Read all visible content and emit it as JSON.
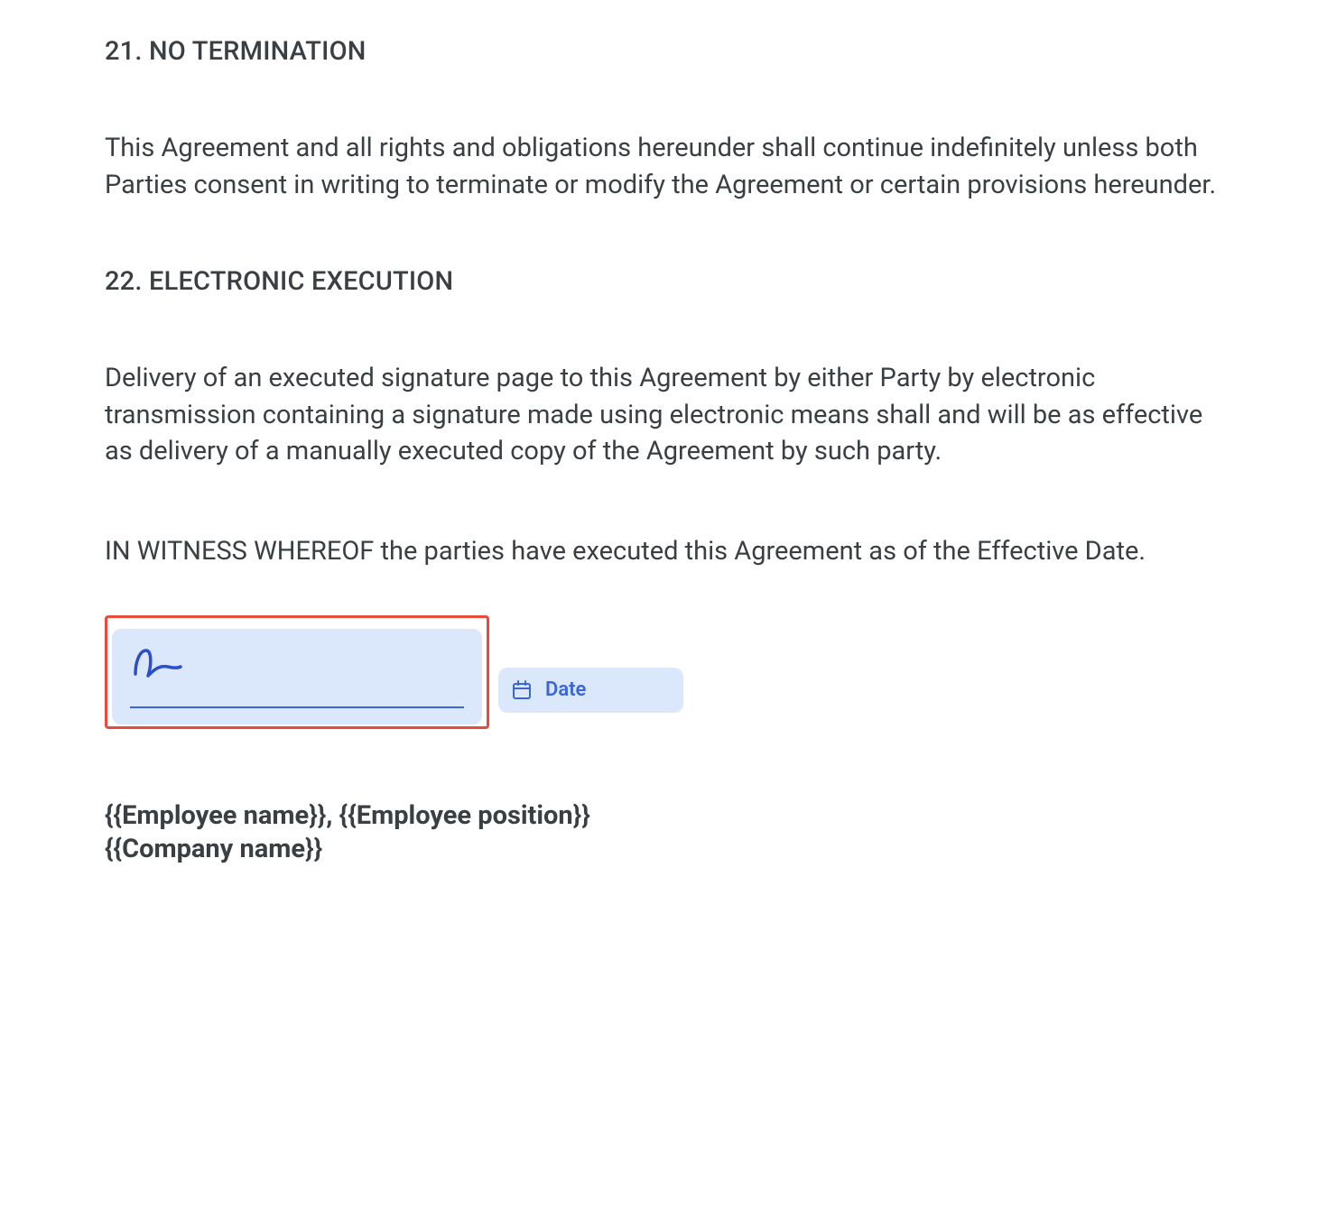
{
  "sections": {
    "s21": {
      "heading": "21. NO TERMINATION",
      "body": "This Agreement and all rights and obligations hereunder shall continue indefinitely unless both Parties consent in writing to terminate or modify the Agreement or certain provisions hereunder."
    },
    "s22": {
      "heading": "22. ELECTRONIC EXECUTION",
      "body": "Delivery of an executed signature page to this Agreement by either Party by electronic transmission containing a signature made using electronic means shall and will be as effective as delivery of a manually executed copy of the Agreement by such party."
    }
  },
  "witness": "IN WITNESS WHEREOF the parties have executed this Agreement as of the Effective Date.",
  "signature": {
    "date_label": "Date"
  },
  "signer": {
    "line1": "{{Employee name}}, {{Employee position}}",
    "line2": "{{Company name}}"
  }
}
